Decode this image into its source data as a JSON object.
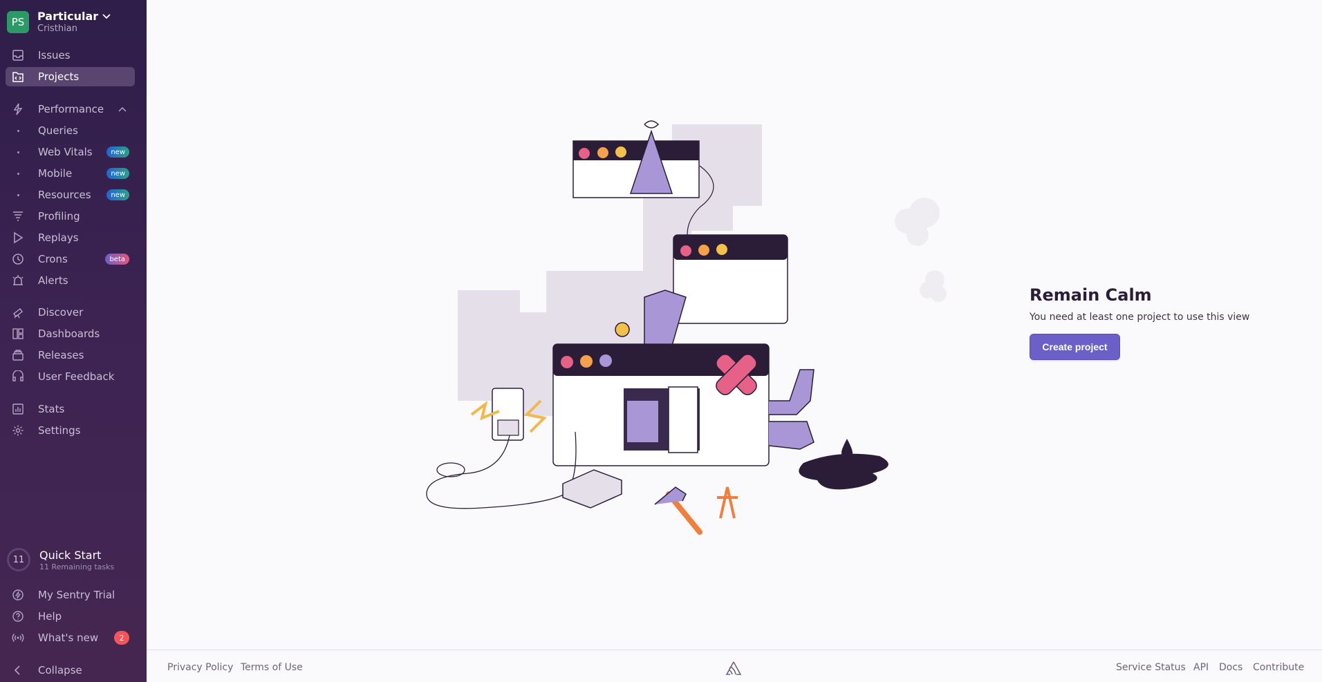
{
  "org": {
    "initials": "PS",
    "name": "Particular",
    "user": "Cristhian"
  },
  "nav": {
    "issues": "Issues",
    "projects": "Projects",
    "performance": "Performance",
    "queries": "Queries",
    "web_vitals": "Web Vitals",
    "mobile": "Mobile",
    "resources": "Resources",
    "profiling": "Profiling",
    "replays": "Replays",
    "crons": "Crons",
    "alerts": "Alerts",
    "discover": "Discover",
    "dashboards": "Dashboards",
    "releases": "Releases",
    "user_feedback": "User Feedback",
    "stats": "Stats",
    "settings": "Settings",
    "badge_new": "new",
    "badge_beta": "beta"
  },
  "quickstart": {
    "count": "11",
    "title": "Quick Start",
    "subtitle": "11 Remaining tasks"
  },
  "bottom_nav": {
    "trial": "My Sentry Trial",
    "help": "Help",
    "whats_new": "What's new",
    "whats_new_count": "2",
    "collapse": "Collapse"
  },
  "empty_state": {
    "title": "Remain Calm",
    "description": "You need at least one project to use this view",
    "button": "Create project"
  },
  "footer": {
    "privacy": "Privacy Policy",
    "terms": "Terms of Use",
    "status": "Service Status",
    "api": "API",
    "docs": "Docs",
    "contribute": "Contribute"
  },
  "colors": {
    "sidebar_top": "#2f1d4a",
    "sidebar_bottom": "#452650",
    "accent": "#6c5fc7",
    "avatar": "#2b9a66",
    "alert_badge": "#f55459"
  }
}
